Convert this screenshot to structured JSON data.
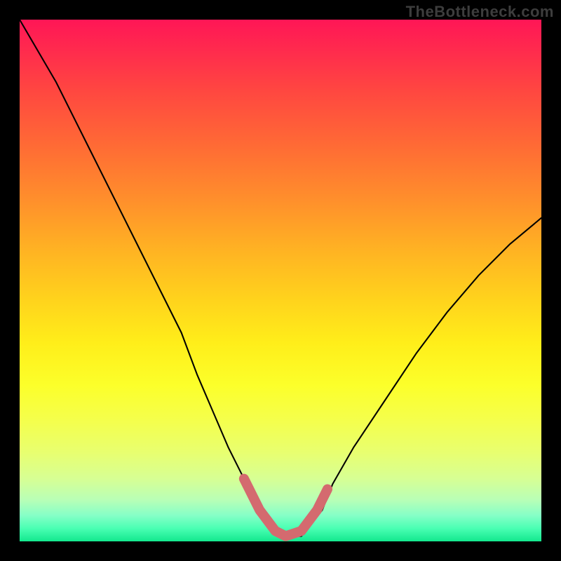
{
  "watermark": "TheBottleneck.com",
  "chart_data": {
    "type": "line",
    "title": "",
    "xlabel": "",
    "ylabel": "",
    "xlim": [
      0,
      100
    ],
    "ylim": [
      0,
      100
    ],
    "gradient_colors": {
      "top": "#ff1656",
      "mid_upper": "#ff8d2c",
      "mid": "#ffee1a",
      "mid_lower": "#d7ff94",
      "bottom": "#13e88e"
    },
    "series": [
      {
        "name": "bottleneck-curve",
        "color": "#000000",
        "x": [
          0,
          7,
          11,
          15,
          19,
          23,
          27,
          31,
          34,
          37,
          40,
          43,
          46,
          50,
          54,
          58,
          60,
          64,
          70,
          76,
          82,
          88,
          94,
          100
        ],
        "y": [
          100,
          88,
          80,
          72,
          64,
          56,
          48,
          40,
          32,
          25,
          18,
          12,
          6,
          1,
          1,
          6,
          11,
          18,
          27,
          36,
          44,
          51,
          57,
          62
        ]
      },
      {
        "name": "flat-minimum-highlight",
        "color": "#d46a6f",
        "x": [
          43,
          46,
          49,
          51,
          54,
          57,
          59
        ],
        "y": [
          12,
          6,
          2,
          1,
          2,
          6,
          10
        ]
      }
    ],
    "annotations": []
  }
}
